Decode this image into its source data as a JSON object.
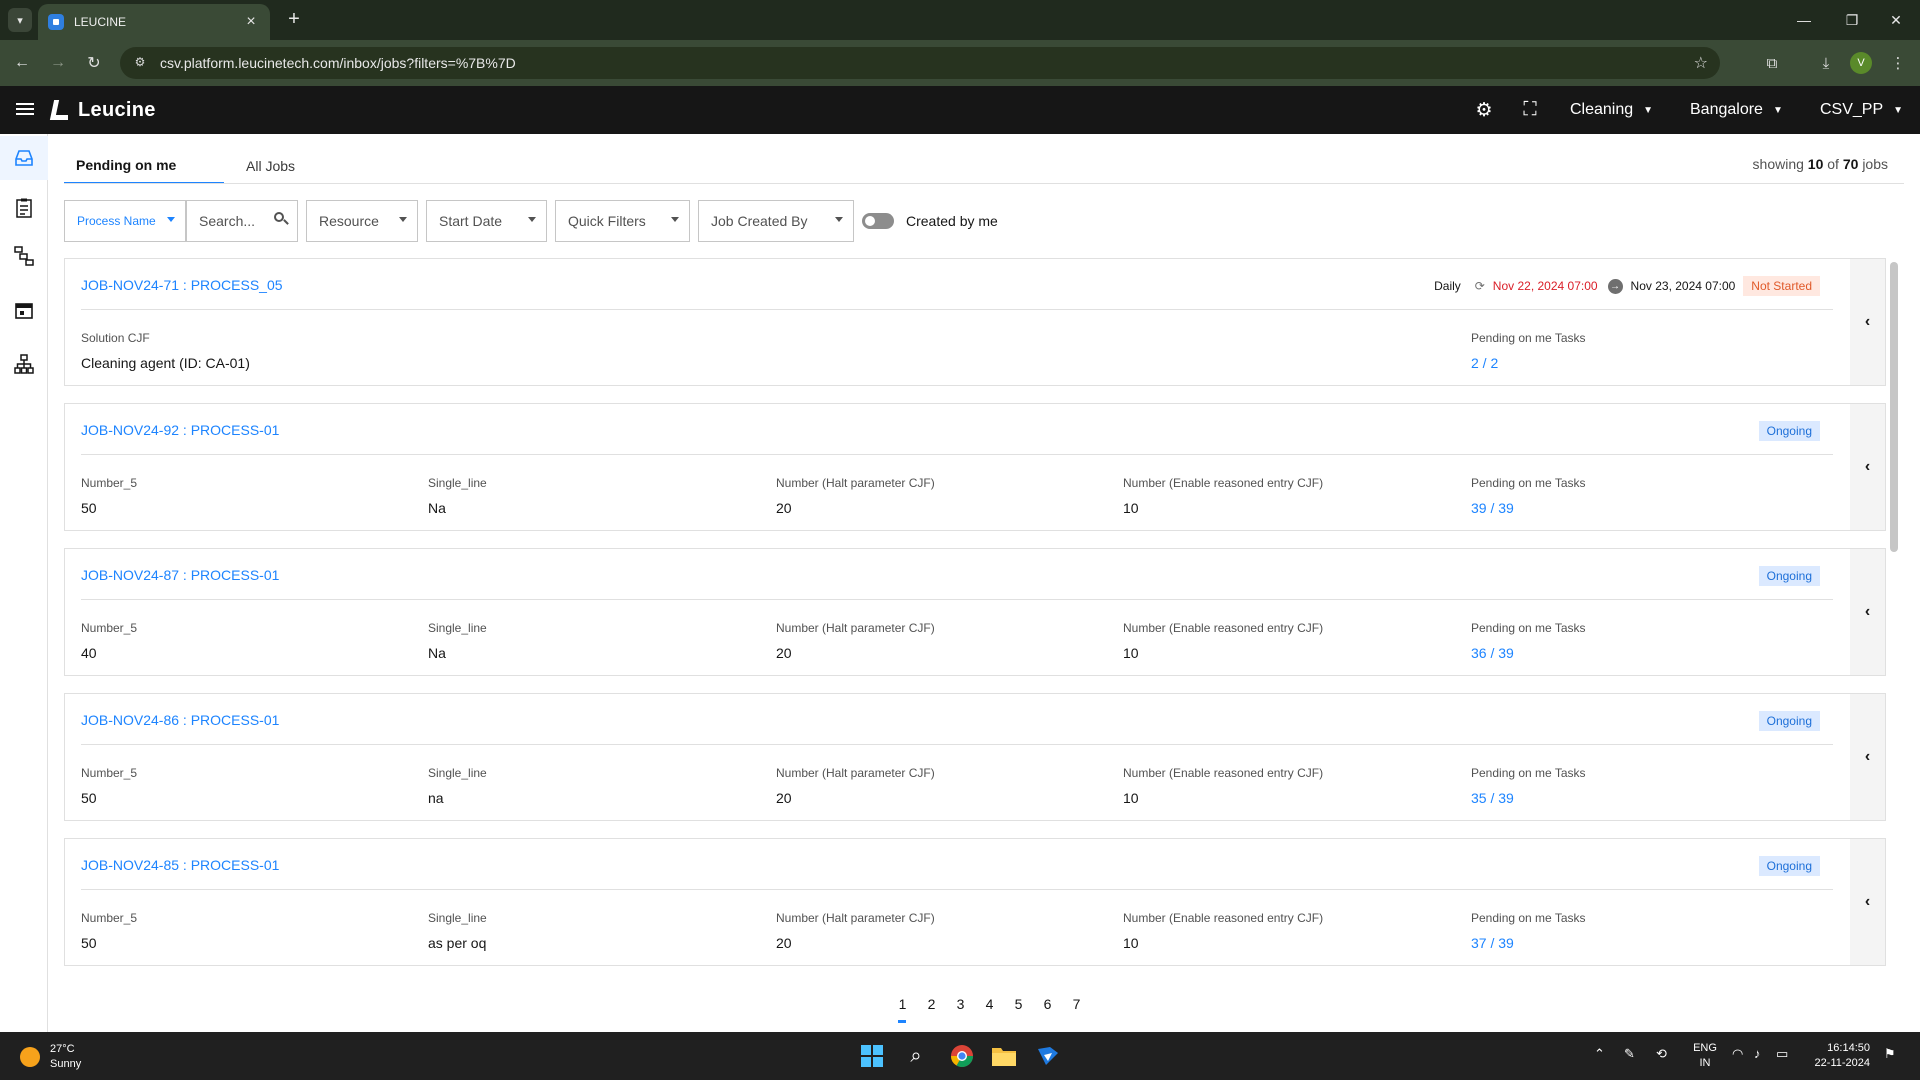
{
  "browser": {
    "tab_title": "LEUCINE",
    "url": "csv.platform.leucinetech.com/inbox/jobs?filters=%7B%7D",
    "profile_initial": "V"
  },
  "header": {
    "logo_text": "Leucine",
    "facility": "Cleaning",
    "location": "Bangalore",
    "use_case": "CSV_PP"
  },
  "tabs": {
    "pending": "Pending on me",
    "all": "All Jobs"
  },
  "showing": {
    "prefix": "showing",
    "count": "10",
    "of": "of",
    "total": "70",
    "suffix": "jobs"
  },
  "filters": {
    "process_name": "Process Name",
    "search_placeholder": "Search...",
    "resource": "Resource",
    "start_date": "Start Date",
    "quick_filters": "Quick Filters",
    "job_created_by": "Job Created By",
    "created_by_me": "Created by me"
  },
  "jobs": [
    {
      "title": "JOB-NOV24-71 : PROCESS_05",
      "frequency": "Daily",
      "start": "Nov 22, 2024 07:00",
      "end": "Nov 23, 2024 07:00",
      "status": "Not Started",
      "fields": [
        {
          "label": "Solution CJF",
          "value": "Cleaning agent (ID: CA-01)"
        }
      ],
      "pending_label": "Pending on me Tasks",
      "pending_value": "2 / 2"
    },
    {
      "title": "JOB-NOV24-92 : PROCESS-01",
      "status": "Ongoing",
      "fields": [
        {
          "label": "Number_5",
          "value": "50"
        },
        {
          "label": "Single_line",
          "value": "Na"
        },
        {
          "label": "Number (Halt parameter CJF)",
          "value": "20"
        },
        {
          "label": "Number (Enable reasoned entry CJF)",
          "value": "10"
        }
      ],
      "pending_label": "Pending on me Tasks",
      "pending_value": "39 / 39"
    },
    {
      "title": "JOB-NOV24-87 : PROCESS-01",
      "status": "Ongoing",
      "fields": [
        {
          "label": "Number_5",
          "value": "40"
        },
        {
          "label": "Single_line",
          "value": "Na"
        },
        {
          "label": "Number (Halt parameter CJF)",
          "value": "20"
        },
        {
          "label": "Number (Enable reasoned entry CJF)",
          "value": "10"
        }
      ],
      "pending_label": "Pending on me Tasks",
      "pending_value": "36 / 39"
    },
    {
      "title": "JOB-NOV24-86 : PROCESS-01",
      "status": "Ongoing",
      "fields": [
        {
          "label": "Number_5",
          "value": "50"
        },
        {
          "label": "Single_line",
          "value": "na"
        },
        {
          "label": "Number (Halt parameter CJF)",
          "value": "20"
        },
        {
          "label": "Number (Enable reasoned entry CJF)",
          "value": "10"
        }
      ],
      "pending_label": "Pending on me Tasks",
      "pending_value": "35 / 39"
    },
    {
      "title": "JOB-NOV24-85 : PROCESS-01",
      "status": "Ongoing",
      "fields": [
        {
          "label": "Number_5",
          "value": "50"
        },
        {
          "label": "Single_line",
          "value": "as per oq"
        },
        {
          "label": "Number (Halt parameter CJF)",
          "value": "20"
        },
        {
          "label": "Number (Enable reasoned entry CJF)",
          "value": "10"
        }
      ],
      "pending_label": "Pending on me Tasks",
      "pending_value": "37 / 39"
    }
  ],
  "pagination": [
    "1",
    "2",
    "3",
    "4",
    "5",
    "6",
    "7"
  ],
  "pagination_active": "1",
  "taskbar": {
    "temperature": "27°C",
    "weather": "Sunny",
    "lang_top": "ENG",
    "lang_bottom": "IN",
    "time": "16:14:50",
    "date": "22-11-2024"
  },
  "colors": {
    "accent": "#1d84ff",
    "not_started": "#e05a2a",
    "ongoing_bg": "#dbe9ff",
    "date_red": "#da1e28",
    "header_bg": "#161616",
    "chrome_bg": "#3a4a36"
  },
  "icons": {
    "rail": [
      "inbox-icon",
      "checklist-icon",
      "workflow-icon",
      "calendar-icon",
      "hierarchy-icon"
    ],
    "header": [
      "gear-icon",
      "scan-icon"
    ]
  }
}
